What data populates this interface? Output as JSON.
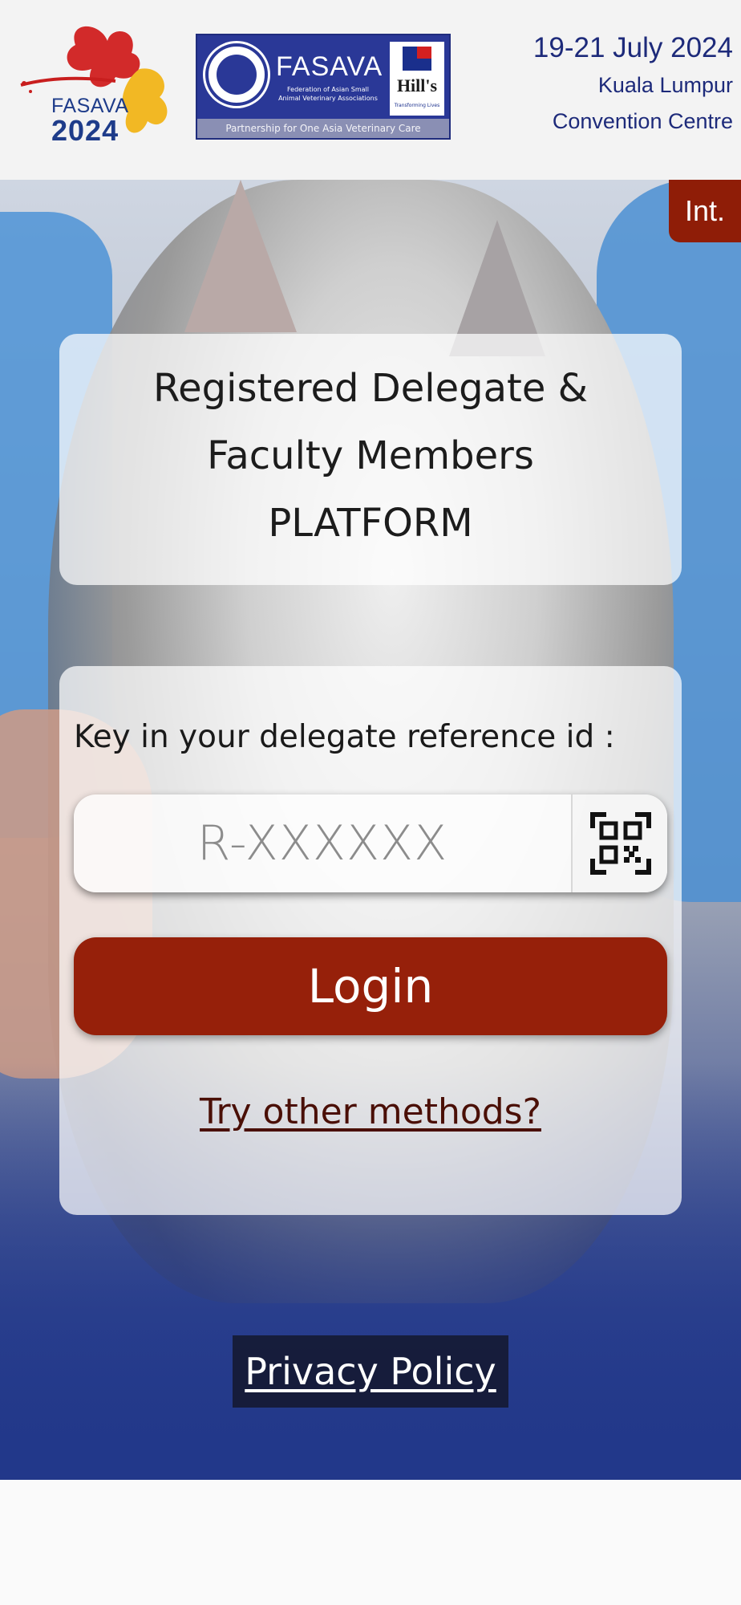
{
  "header": {
    "logo_brand": "FASAVA",
    "logo_year": "2024",
    "partner": {
      "name": "FASAVA",
      "full_name": "Federation of Asian Small Animal Veterinary Associations",
      "sponsor": "Hill's",
      "sponsor_tagline": "Transforming Lives",
      "tagline": "Partnership for One Asia Veterinary Care"
    },
    "event_dates": "19-21 July 2024",
    "venue_line1": "Kuala Lumpur",
    "venue_line2": "Convention Centre"
  },
  "language_badge": "Int.",
  "title_card": {
    "line1": "Registered Delegate &",
    "line2": "Faculty Members",
    "line3": "PLATFORM"
  },
  "login": {
    "prompt": "Key in your delegate reference id :",
    "reference_placeholder": "R-XXXXXX",
    "reference_value": "",
    "qr_icon": "qr-code-icon",
    "login_label": "Login",
    "other_methods_label": "Try other methods?"
  },
  "footer": {
    "privacy_label": "Privacy Policy"
  },
  "colors": {
    "accent_red": "#96200a",
    "header_navy": "#1d2a7a",
    "hero_blue": "#22388a"
  }
}
